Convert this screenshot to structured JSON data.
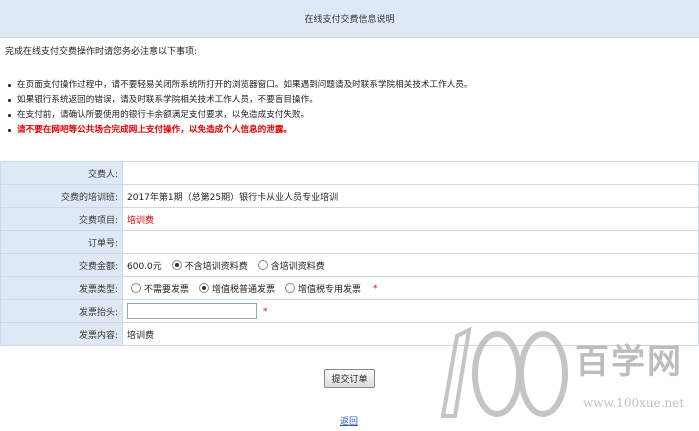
{
  "header": {
    "title": "在线支付交费信息说明"
  },
  "intro": "完成在线支付交费操作时请您务必注意以下事项:",
  "notices": [
    "在页面支付操作过程中，请不要轻易关闭所系统所打开的浏览器窗口。如果遇到问题请及时联系学院相关技术工作人员。",
    "如果银行系统返回的错误，请及时联系学院相关技术工作人员，不要盲目操作。",
    "在支付前，请确认所要使用的银行卡余额满足支付要求，以免造成支付失败。",
    "请不要在网吧等公共场合完成网上支付操作，以免造成个人信息的泄露。"
  ],
  "form": {
    "payer_label": "交费人:",
    "payer_value": "",
    "class_label": "交费的培训班:",
    "class_value": "2017年第1期（总第25期）银行卡从业人员专业培训",
    "item_label": "交费项目:",
    "item_value": "培训费",
    "order_label": "订单号:",
    "order_value": "",
    "amount_label": "交费金额:",
    "amount_value": "600.0元",
    "amount_opt1": "不含培训资料费",
    "amount_opt2": "含培训资料费",
    "invoice_type_label": "发票类型:",
    "invoice_opt1": "不需要发票",
    "invoice_opt2": "增值税普通发票",
    "invoice_opt3": "增值税专用发票",
    "required_mark": "*",
    "invoice_title_label": "发票抬头:",
    "invoice_title_value": "",
    "invoice_content_label": "发票内容:",
    "invoice_content_value": "培训费"
  },
  "submit_label": "提交订单",
  "back_label": "返回",
  "watermark": {
    "cn": "百学网",
    "url": "www.100xue.net"
  }
}
